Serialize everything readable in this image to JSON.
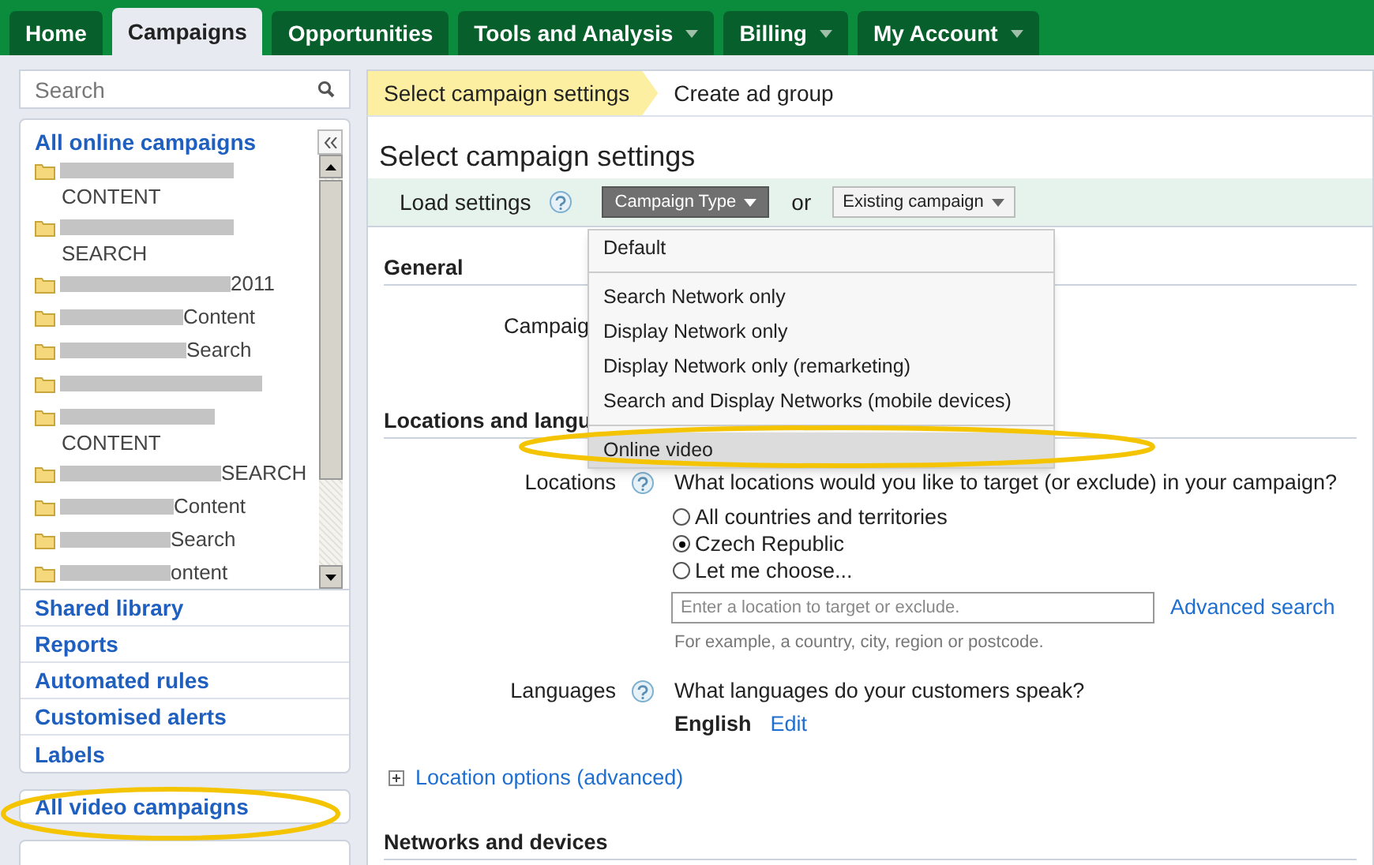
{
  "nav_tabs": [
    {
      "label": "Home",
      "selected": false,
      "has_menu": false
    },
    {
      "label": "Campaigns",
      "selected": true,
      "has_menu": false
    },
    {
      "label": "Opportunities",
      "selected": false,
      "has_menu": false
    },
    {
      "label": "Tools and Analysis",
      "selected": false,
      "has_menu": true
    },
    {
      "label": "Billing",
      "selected": false,
      "has_menu": true
    },
    {
      "label": "My Account",
      "selected": false,
      "has_menu": true
    }
  ],
  "sidebar": {
    "search": {
      "placeholder": "Search"
    },
    "campaigns_title": "All online campaigns",
    "campaigns": [
      {
        "kind": "two_line",
        "text": "CONTENT"
      },
      {
        "kind": "two_line",
        "text": "SEARCH"
      },
      {
        "kind": "one_line",
        "text": "2011"
      },
      {
        "kind": "one_line",
        "text": "Content"
      },
      {
        "kind": "one_line",
        "text": "Search"
      },
      {
        "kind": "one_line"
      },
      {
        "kind": "two_line",
        "text": "CONTENT"
      },
      {
        "kind": "one_line",
        "text": "SEARCH"
      },
      {
        "kind": "one_line",
        "text": "Content"
      },
      {
        "kind": "one_line",
        "text": "Search"
      },
      {
        "kind": "one_line",
        "text": "ontent"
      }
    ],
    "links": [
      "Shared library",
      "Reports",
      "Automated rules",
      "Customised alerts",
      "Labels"
    ],
    "video_campaigns": {
      "label": "All video campaigns",
      "highlighted": true
    }
  },
  "main": {
    "steps": [
      {
        "label": "Select campaign settings",
        "selected": true
      },
      {
        "label": "Create ad group",
        "selected": false
      }
    ],
    "title": "Select campaign settings",
    "load_settings": {
      "label": "Load settings",
      "campaign_type": "Campaign Type",
      "or": "or",
      "existing": "Existing campaign"
    },
    "dropdown": {
      "groups": [
        [
          {
            "label": "Default",
            "selected": false
          }
        ],
        [
          {
            "label": "Search Network only",
            "selected": false
          },
          {
            "label": "Display Network only",
            "selected": false
          },
          {
            "label": "Display Network only (remarketing)",
            "selected": false
          },
          {
            "label": "Search and Display Networks (mobile devices)",
            "selected": false
          }
        ],
        [
          {
            "label": "Online video",
            "selected": true,
            "highlighted": true
          }
        ]
      ]
    },
    "general": {
      "title": "General",
      "campaign_label": "Campaig"
    },
    "locations_section": {
      "title": "Locations and langu"
    },
    "locations": {
      "label": "Locations",
      "question": "What locations would you like to target (or exclude) in your campaign?",
      "options": [
        {
          "label": "All countries and territories",
          "selected": false
        },
        {
          "label": "Czech Republic",
          "selected": true
        },
        {
          "label": "Let me choose...",
          "selected": false
        }
      ],
      "search": {
        "placeholder": "Enter a location to target or exclude."
      },
      "advanced": "Advanced search",
      "hint": "For example, a country, city, region or postcode."
    },
    "languages": {
      "label": "Languages",
      "question": "What languages do your customers speak?",
      "value": "English",
      "edit": "Edit"
    },
    "location_options": "Location options (advanced)",
    "networks_title": "Networks and devices"
  }
}
